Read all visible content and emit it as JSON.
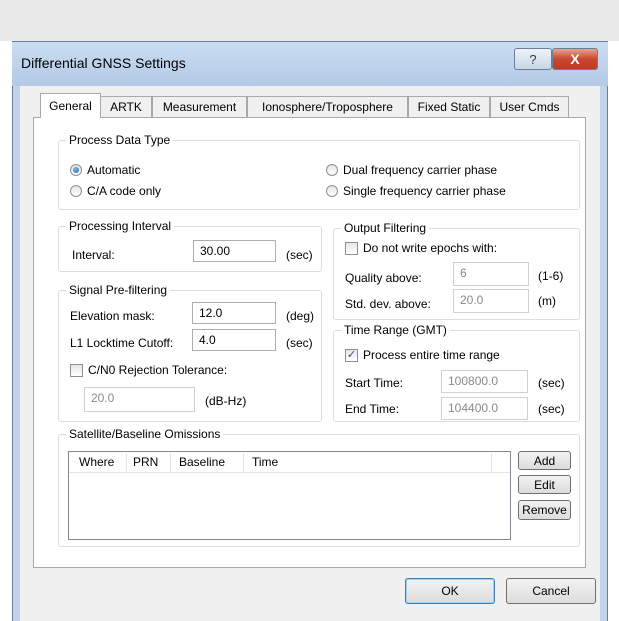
{
  "window": {
    "title": "Differential GNSS Settings",
    "help_glyph": "?",
    "close_glyph": "X"
  },
  "tabs": [
    "General",
    "ARTK",
    "Measurement",
    "Ionosphere/Troposphere",
    "Fixed Static",
    "User Cmds"
  ],
  "process_data_type": {
    "label": "Process Data Type",
    "options": [
      "Automatic",
      "C/A code only",
      "Dual frequency carrier phase",
      "Single frequency carrier phase"
    ],
    "selected": "Automatic"
  },
  "processing_interval": {
    "label": "Processing Interval",
    "interval_label": "Interval:",
    "value": "30.00",
    "unit": "(sec)"
  },
  "signal_prefiltering": {
    "label": "Signal Pre-filtering",
    "elevation_label": "Elevation mask:",
    "elevation_value": "12.0",
    "elevation_unit": "(deg)",
    "locktime_label": "L1 Locktime Cutoff:",
    "locktime_value": "4.0",
    "locktime_unit": "(sec)",
    "cn0_label": "C/N0 Rejection Tolerance:",
    "cn0_checked": false,
    "cn0_value": "20.0",
    "cn0_unit": "(dB-Hz)"
  },
  "output_filtering": {
    "label": "Output Filtering",
    "no_write_label": "Do not write epochs with:",
    "no_write_checked": false,
    "quality_label": "Quality above:",
    "quality_value": "6",
    "quality_unit": "(1-6)",
    "stddev_label": "Std. dev. above:",
    "stddev_value": "20.0",
    "stddev_unit": "(m)"
  },
  "time_range": {
    "label": "Time Range (GMT)",
    "entire_label": "Process entire time range",
    "entire_checked": true,
    "check_glyph": "✓",
    "start_label": "Start Time:",
    "start_value": "100800.0",
    "start_unit": "(sec)",
    "end_label": "End Time:",
    "end_value": "104400.0",
    "end_unit": "(sec)"
  },
  "omissions": {
    "label": "Satellite/Baseline Omissions",
    "columns": [
      "Where",
      "PRN",
      "Baseline",
      "Time"
    ],
    "rows": [],
    "buttons": [
      "Add",
      "Edit",
      "Remove"
    ]
  },
  "footer": {
    "ok_label": "OK",
    "cancel_label": "Cancel"
  }
}
